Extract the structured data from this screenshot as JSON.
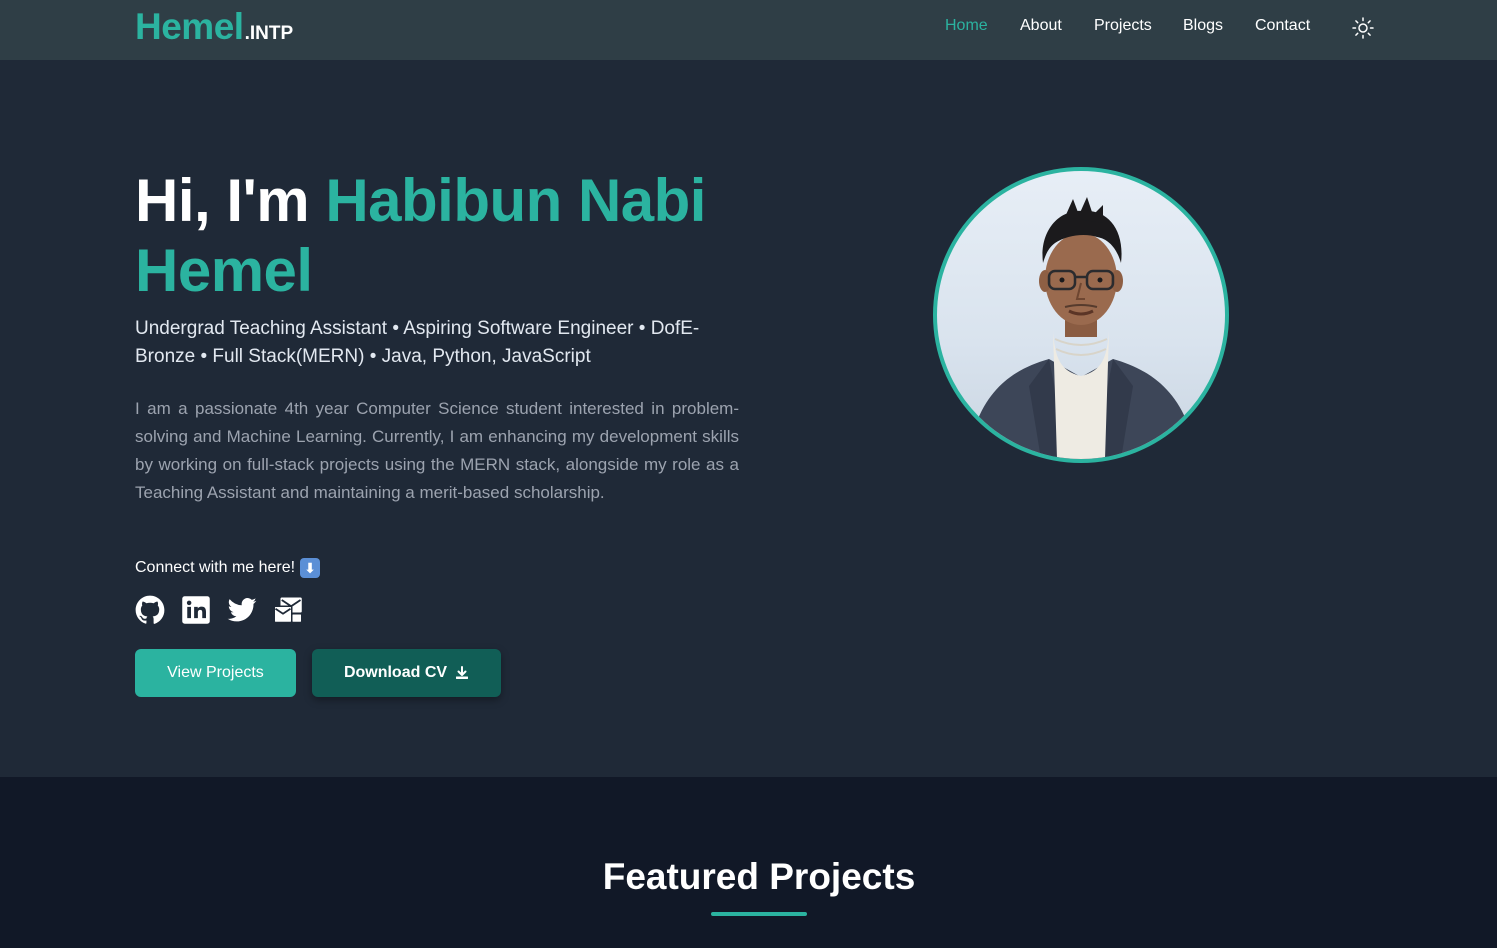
{
  "nav": {
    "logo_main": "Hemel",
    "logo_sub": ".INTP",
    "links": [
      "Home",
      "About",
      "Projects",
      "Blogs",
      "Contact"
    ],
    "active_link": "Home",
    "theme_icon": "sun-icon"
  },
  "hero": {
    "greeting": "Hi, I'm",
    "name": "Habibun Nabi Hemel",
    "roles": "Undergrad Teaching Assistant • Aspiring Software Engineer • DofE-Bronze • Full Stack(MERN) • Java, Python, JavaScript",
    "bio": "I am a passionate 4th year Computer Science student interested in problem-solving and Machine Learning. Currently, I am enhancing my development skills by working on full-stack projects using the MERN stack, alongside my role as a Teaching Assistant and maintaining a merit-based scholarship.",
    "connect_text": "Connect with me here!",
    "connect_emoji": "⬇",
    "socials": [
      "github-icon",
      "linkedin-icon",
      "twitter-icon",
      "email-icon"
    ],
    "view_projects_label": "View Projects",
    "download_cv_label": "Download CV"
  },
  "featured": {
    "title": "Featured Projects"
  },
  "colors": {
    "accent": "#2bb3a0",
    "nav_bg": "#2f3e46",
    "hero_bg": "#1f2937",
    "featured_bg": "#111827",
    "secondary_button": "#115e56"
  }
}
